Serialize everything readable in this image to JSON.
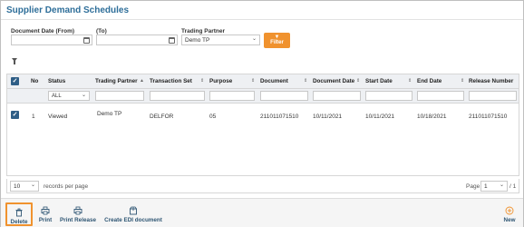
{
  "page": {
    "title": "Supplier Demand Schedules"
  },
  "filters": {
    "doc_date_from_label": "Document Date (From)",
    "doc_date_to_label": "(To)",
    "trading_partner_label": "Trading Partner",
    "trading_partner_value": "Demo TP",
    "filter_button": "Filter"
  },
  "table": {
    "columns": {
      "no": "No",
      "status": "Status",
      "trading_partner": "Trading Partner",
      "transaction_set": "Transaction Set",
      "purpose": "Purpose",
      "document": "Document",
      "document_date": "Document Date",
      "start_date": "Start Date",
      "end_date": "End Date",
      "release_number": "Release Number"
    },
    "status_filter": "ALL",
    "rows": [
      {
        "no": "1",
        "status": "Viewed",
        "trading_partner": "Demo TP",
        "transaction_set": "DELFOR",
        "purpose": "05",
        "document": "211011071510",
        "document_date": "10/11/2021",
        "start_date": "10/11/2021",
        "end_date": "10/18/2021",
        "release_number": "211011071510"
      }
    ]
  },
  "pager": {
    "per_page": "10",
    "per_page_label": "records per page",
    "page_label": "Page",
    "page_value": "1",
    "page_total": "/ 1"
  },
  "toolbar": {
    "delete": "Delete",
    "print": "Print",
    "print_release": "Print Release",
    "create_edi": "Create EDI document",
    "new": "New"
  },
  "colors": {
    "accent": "#f0922e",
    "title": "#2e6e99",
    "checkbox": "#2f5e86"
  }
}
